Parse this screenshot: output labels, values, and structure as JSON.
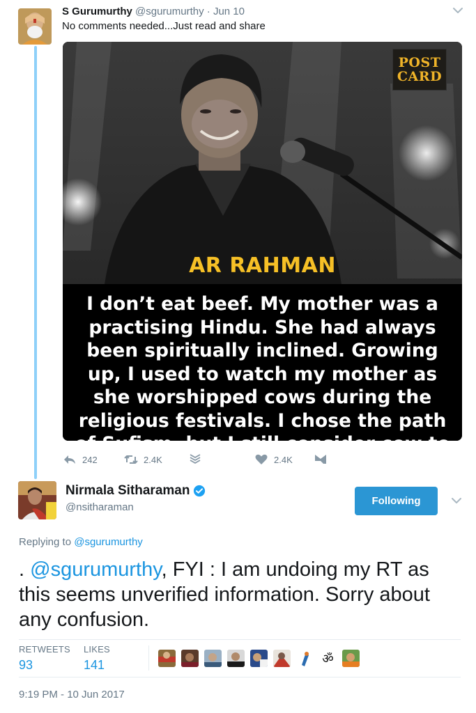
{
  "quoted_tweet": {
    "name": "S Gurumurthy",
    "handle": "@sgurumurthy",
    "separator": "·",
    "date": "Jun 10",
    "text": "No comments needed...Just read and share",
    "media": {
      "badge_line1": "POST",
      "badge_line2": "CARD",
      "headline": "AR RAHMAN",
      "quote": "I don’t eat beef. My mother was a practising Hindu. She had always been spiritually inclined. Growing up, I used to watch my mother as she worshipped cows during the religious festivals. I chose the path of Sufism, but I still consider cow to be a sacred"
    },
    "actions": {
      "reply_count": "242",
      "retweet_count": "2.4K",
      "like_count": "2.4K"
    }
  },
  "main_tweet": {
    "name": "Nirmala Sitharaman",
    "handle": "@nsitharaman",
    "follow_label": "Following",
    "replying_prefix": "Replying to",
    "replying_mention": "@sgurumurthy",
    "text_prefix": ". ",
    "text_mention": "@sgurumurthy",
    "text_rest": ", FYI : I am undoing my RT as this seems unverified information. Sorry about any confusion.",
    "retweets_label": "RETWEETS",
    "retweets_value": "93",
    "likes_label": "LIKES",
    "likes_value": "141",
    "timestamp": "9:19 PM - 10 Jun 2017"
  },
  "colors": {
    "accent": "#1b95e0",
    "follow_button": "#2b96d4",
    "thread_line": "#8ed0f9",
    "secondary_text": "#657786",
    "headline_yellow": "#f6c026"
  },
  "icons": [
    "chevron-down-icon",
    "reply-icon",
    "retweet-icon",
    "stack-icon",
    "heart-icon",
    "message-icon",
    "verified-badge-icon"
  ]
}
